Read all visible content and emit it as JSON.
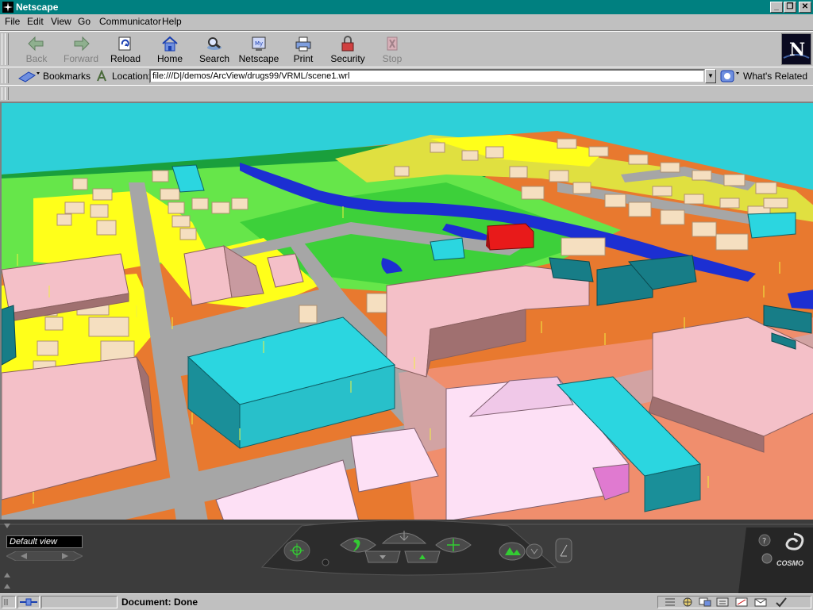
{
  "window": {
    "title": "Netscape"
  },
  "menu": [
    "File",
    "Edit",
    "View",
    "Go",
    "Communicator",
    "Help"
  ],
  "toolbar": {
    "buttons": [
      {
        "label": "Back",
        "icon": "back-arrow-icon",
        "enabled": false
      },
      {
        "label": "Forward",
        "icon": "forward-arrow-icon",
        "enabled": false
      },
      {
        "label": "Reload",
        "icon": "reload-icon",
        "enabled": true
      },
      {
        "label": "Home",
        "icon": "home-icon",
        "enabled": true
      },
      {
        "label": "Search",
        "icon": "search-icon",
        "enabled": true
      },
      {
        "label": "Netscape",
        "icon": "my-netscape-icon",
        "enabled": true
      },
      {
        "label": "Print",
        "icon": "printer-icon",
        "enabled": true
      },
      {
        "label": "Security",
        "icon": "padlock-icon",
        "enabled": true
      },
      {
        "label": "Stop",
        "icon": "stop-icon",
        "enabled": false
      }
    ]
  },
  "location": {
    "bookmarks_label": "Bookmarks",
    "location_label": "Location:",
    "url": "file:///D|/demos/ArcView/drugs99/VRML/scene1.wrl",
    "related_label": "What's Related"
  },
  "viewer": {
    "viewpoint": "Default view",
    "brand": "COSMO"
  },
  "status": {
    "text": "Document: Done"
  },
  "colors": {
    "titlebar": "#008080",
    "chrome": "#c0c0c0",
    "sky": "#2ed0d8",
    "road": "#a6a6a6",
    "water": "#1c2fd2"
  }
}
